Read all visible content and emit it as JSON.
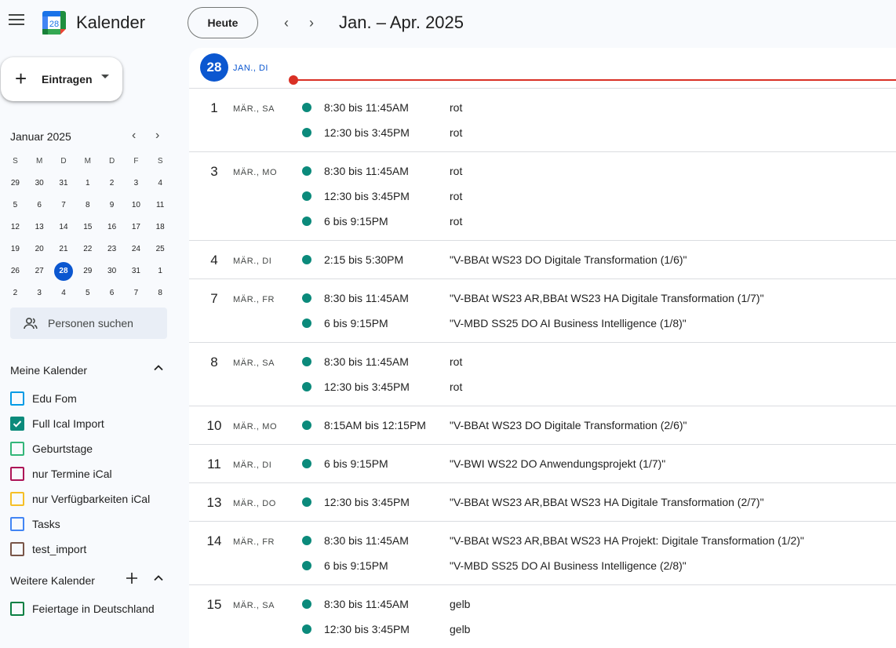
{
  "header": {
    "app_title": "Kalender",
    "today_button": "Heute",
    "date_range": "Jan. – Apr. 2025",
    "logo_day": "28"
  },
  "sidebar": {
    "create_label": "Eintragen",
    "mini_calendar": {
      "month": "Januar 2025",
      "weekdays": [
        "S",
        "M",
        "D",
        "M",
        "D",
        "F",
        "S"
      ],
      "weeks": [
        [
          "29",
          "30",
          "31",
          "1",
          "2",
          "3",
          "4"
        ],
        [
          "5",
          "6",
          "7",
          "8",
          "9",
          "10",
          "11"
        ],
        [
          "12",
          "13",
          "14",
          "15",
          "16",
          "17",
          "18"
        ],
        [
          "19",
          "20",
          "21",
          "22",
          "23",
          "24",
          "25"
        ],
        [
          "26",
          "27",
          "28",
          "29",
          "30",
          "31",
          "1"
        ],
        [
          "2",
          "3",
          "4",
          "5",
          "6",
          "7",
          "8"
        ]
      ],
      "today": "28"
    },
    "people_search": "Personen suchen",
    "my_calendars_title": "Meine Kalender",
    "my_calendars": [
      {
        "label": "Edu Fom",
        "color": "#039be5",
        "checked": false
      },
      {
        "label": "Full Ical Import",
        "color": "#0b8a7b",
        "checked": true
      },
      {
        "label": "Geburtstage",
        "color": "#33b679",
        "checked": false
      },
      {
        "label": "nur Termine iCal",
        "color": "#ad1457",
        "checked": false
      },
      {
        "label": "nur Verfügbarkeiten iCal",
        "color": "#f6bf26",
        "checked": false
      },
      {
        "label": "Tasks",
        "color": "#4285f4",
        "checked": false
      },
      {
        "label": "test_import",
        "color": "#795548",
        "checked": false
      }
    ],
    "other_calendars_title": "Weitere Kalender",
    "other_calendars": [
      {
        "label": "Feiertage in Deutschland",
        "color": "#0b8043",
        "checked": false
      }
    ]
  },
  "today": {
    "day": "28",
    "label": "JAN., DI"
  },
  "schedule": [
    {
      "day": "1",
      "label": "MÄR., SA",
      "events": [
        {
          "time": "8:30 bis 11:45AM",
          "title": "rot"
        },
        {
          "time": "12:30 bis 3:45PM",
          "title": "rot"
        }
      ]
    },
    {
      "day": "3",
      "label": "MÄR., MO",
      "events": [
        {
          "time": "8:30 bis 11:45AM",
          "title": "rot"
        },
        {
          "time": "12:30 bis 3:45PM",
          "title": "rot"
        },
        {
          "time": "6 bis 9:15PM",
          "title": "rot"
        }
      ]
    },
    {
      "day": "4",
      "label": "MÄR., DI",
      "events": [
        {
          "time": "2:15 bis 5:30PM",
          "title": "\"V-BBAt WS23 DO Digitale Transformation (1/6)\""
        }
      ]
    },
    {
      "day": "7",
      "label": "MÄR., FR",
      "events": [
        {
          "time": "8:30 bis 11:45AM",
          "title": "\"V-BBAt WS23 AR,BBAt WS23 HA Digitale Transformation (1/7)\""
        },
        {
          "time": "6 bis 9:15PM",
          "title": "\"V-MBD SS25 DO AI Business Intelligence (1/8)\""
        }
      ]
    },
    {
      "day": "8",
      "label": "MÄR., SA",
      "events": [
        {
          "time": "8:30 bis 11:45AM",
          "title": "rot"
        },
        {
          "time": "12:30 bis 3:45PM",
          "title": "rot"
        }
      ]
    },
    {
      "day": "10",
      "label": "MÄR., MO",
      "events": [
        {
          "time": "8:15AM bis 12:15PM",
          "title": "\"V-BBAt WS23 DO Digitale Transformation (2/6)\""
        }
      ]
    },
    {
      "day": "11",
      "label": "MÄR., DI",
      "events": [
        {
          "time": "6 bis 9:15PM",
          "title": "\"V-BWI WS22 DO Anwendungsprojekt (1/7)\""
        }
      ]
    },
    {
      "day": "13",
      "label": "MÄR., DO",
      "events": [
        {
          "time": "12:30 bis 3:45PM",
          "title": "\"V-BBAt WS23 AR,BBAt WS23 HA Digitale Transformation (2/7)\""
        }
      ]
    },
    {
      "day": "14",
      "label": "MÄR., FR",
      "events": [
        {
          "time": "8:30 bis 11:45AM",
          "title": "\"V-BBAt WS23 AR,BBAt WS23 HA Projekt: Digitale Transformation (1/2)\""
        },
        {
          "time": "6 bis 9:15PM",
          "title": "\"V-MBD SS25 DO AI Business Intelligence (2/8)\""
        }
      ]
    },
    {
      "day": "15",
      "label": "MÄR., SA",
      "events": [
        {
          "time": "8:30 bis 11:45AM",
          "title": "gelb"
        },
        {
          "time": "12:30 bis 3:45PM",
          "title": "gelb"
        }
      ]
    }
  ],
  "colors": {
    "accent": "#0b57d0",
    "now_line": "#d93025",
    "event_dot": "#0b8a7b"
  }
}
